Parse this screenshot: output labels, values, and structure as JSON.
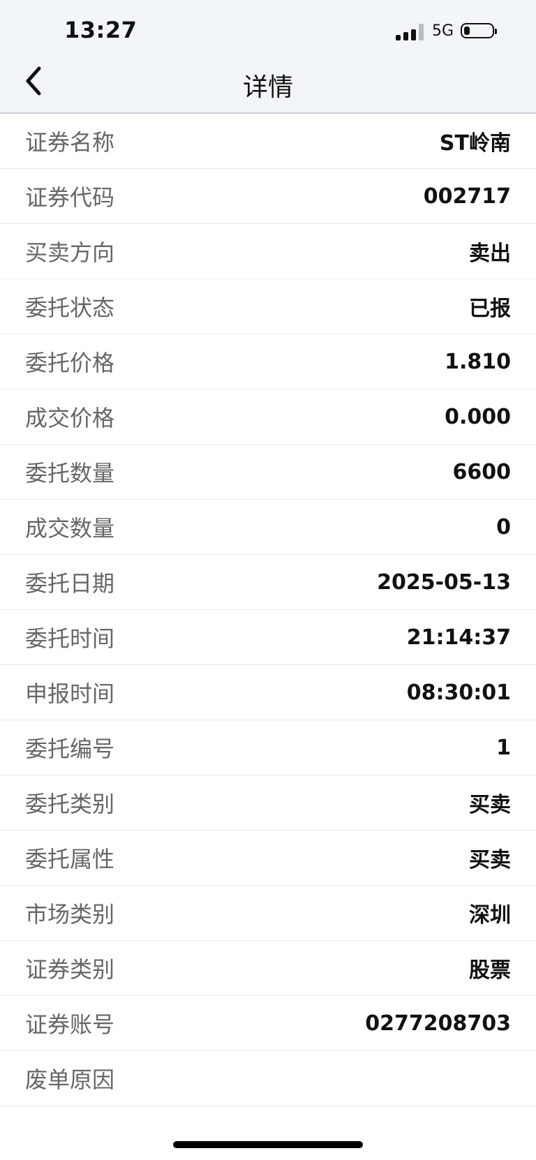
{
  "status_bar": {
    "time": "13:27",
    "network": "5G",
    "battery_level": 0.2
  },
  "header": {
    "title": "详情",
    "back_icon": "chevron-left-icon"
  },
  "details": [
    {
      "label": "证券名称",
      "value": "ST岭南"
    },
    {
      "label": "证券代码",
      "value": "002717"
    },
    {
      "label": "买卖方向",
      "value": "卖出"
    },
    {
      "label": "委托状态",
      "value": "已报"
    },
    {
      "label": "委托价格",
      "value": "1.810"
    },
    {
      "label": "成交价格",
      "value": "0.000"
    },
    {
      "label": "委托数量",
      "value": "6600"
    },
    {
      "label": "成交数量",
      "value": "0"
    },
    {
      "label": "委托日期",
      "value": "2025-05-13"
    },
    {
      "label": "委托时间",
      "value": "21:14:37"
    },
    {
      "label": "申报时间",
      "value": "08:30:01"
    },
    {
      "label": "委托编号",
      "value": "1"
    },
    {
      "label": "委托类别",
      "value": "买卖"
    },
    {
      "label": "委托属性",
      "value": "买卖"
    },
    {
      "label": "市场类别",
      "value": "深圳"
    },
    {
      "label": "证券类别",
      "value": "股票"
    },
    {
      "label": "证券账号",
      "value": "0277208703"
    },
    {
      "label": "废单原因",
      "value": ""
    }
  ]
}
